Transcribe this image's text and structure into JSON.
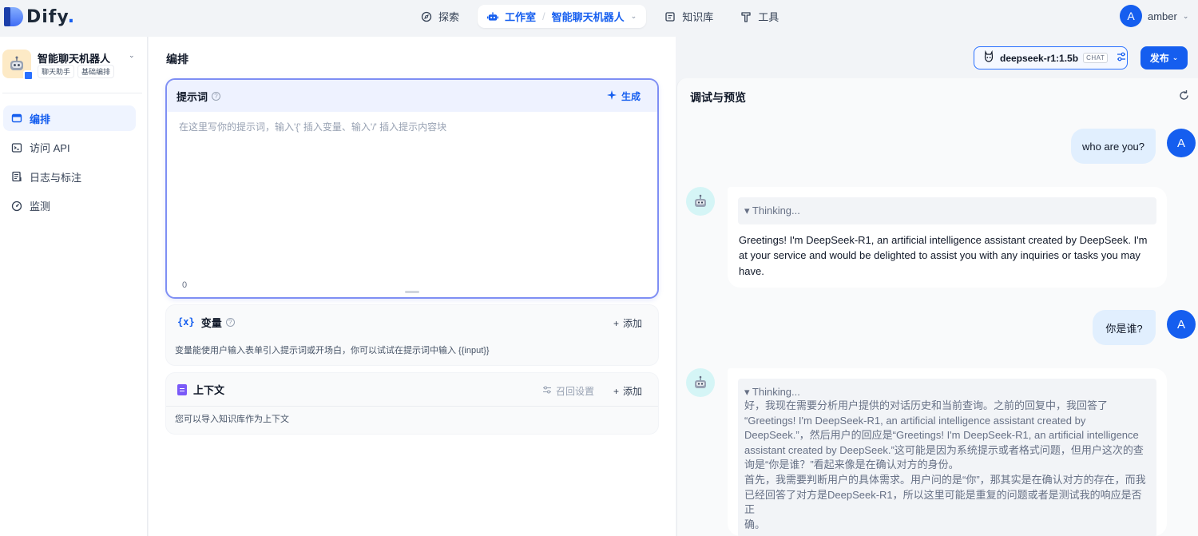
{
  "brand": {
    "name": "Dify",
    "dot": "."
  },
  "nav": {
    "explore": "探索",
    "studio": "工作室",
    "sep": "/",
    "current_app": "智能聊天机器人",
    "knowledge": "知识库",
    "tools": "工具"
  },
  "account": {
    "initial": "A",
    "name": "amber"
  },
  "app": {
    "name": "智能聊天机器人",
    "tags": [
      "聊天助手",
      "基础编排"
    ]
  },
  "sidebar": {
    "items": [
      {
        "label": "编排",
        "icon": "layout-icon",
        "active": true
      },
      {
        "label": "访问 API",
        "icon": "terminal-icon",
        "active": false
      },
      {
        "label": "日志与标注",
        "icon": "log-icon",
        "active": false
      },
      {
        "label": "监测",
        "icon": "gauge-icon",
        "active": false
      }
    ]
  },
  "main": {
    "title": "编排",
    "prompt": {
      "label": "提示词",
      "help": "?",
      "generate": "生成",
      "placeholder": "在这里写你的提示词，输入'{' 插入变量、输入'/' 插入提示内容块",
      "count": "0"
    },
    "variables": {
      "icon": "{x}",
      "label": "变量",
      "add": "添加",
      "desc": "变量能使用户输入表单引入提示词或开场白，你可以试试在提示词中输入 {{input}}"
    },
    "context": {
      "label": "上下文",
      "recall": "召回设置",
      "add": "添加",
      "desc": "您可以导入知识库作为上下文"
    }
  },
  "toolbar": {
    "model": "deepseek-r1:1.5b",
    "mode": "CHAT",
    "publish": "发布"
  },
  "debug": {
    "title": "调试与预览",
    "messages": [
      {
        "role": "user",
        "text": "who are you?"
      },
      {
        "role": "bot",
        "thinking": "▾ Thinking...",
        "answer_lines": [
          "Greetings! I'm DeepSeek-R1, an artificial intelligence assistant created by DeepSeek. I'm",
          "at your service and would be delighted to assist you with any inquiries or tasks you may",
          "have."
        ]
      },
      {
        "role": "user",
        "text": "你是谁?"
      },
      {
        "role": "bot",
        "thinking": "▾ Thinking...",
        "thinking_lines": [
          "好，我现在需要分析用户提供的对话历史和当前查询。之前的回复中，我回答了",
          "“Greetings! I'm DeepSeek-R1, an artificial intelligence assistant created by",
          "DeepSeek.”，然后用户的回应是“Greetings! I'm DeepSeek-R1, an artificial intelligence",
          "assistant created by DeepSeek.”这可能是因为系统提示或者格式问题，但用户这次的查",
          "询是“你是谁？”看起来像是在确认对方的身份。",
          "首先，我需要判断用户的具体需求。用户问的是“你”，那其实是在确认对方的存在，而我",
          "已经回答了对方是DeepSeek-R1，所以这里可能是重复的问题或者是测试我的响应是否正",
          "确。"
        ]
      }
    ]
  }
}
